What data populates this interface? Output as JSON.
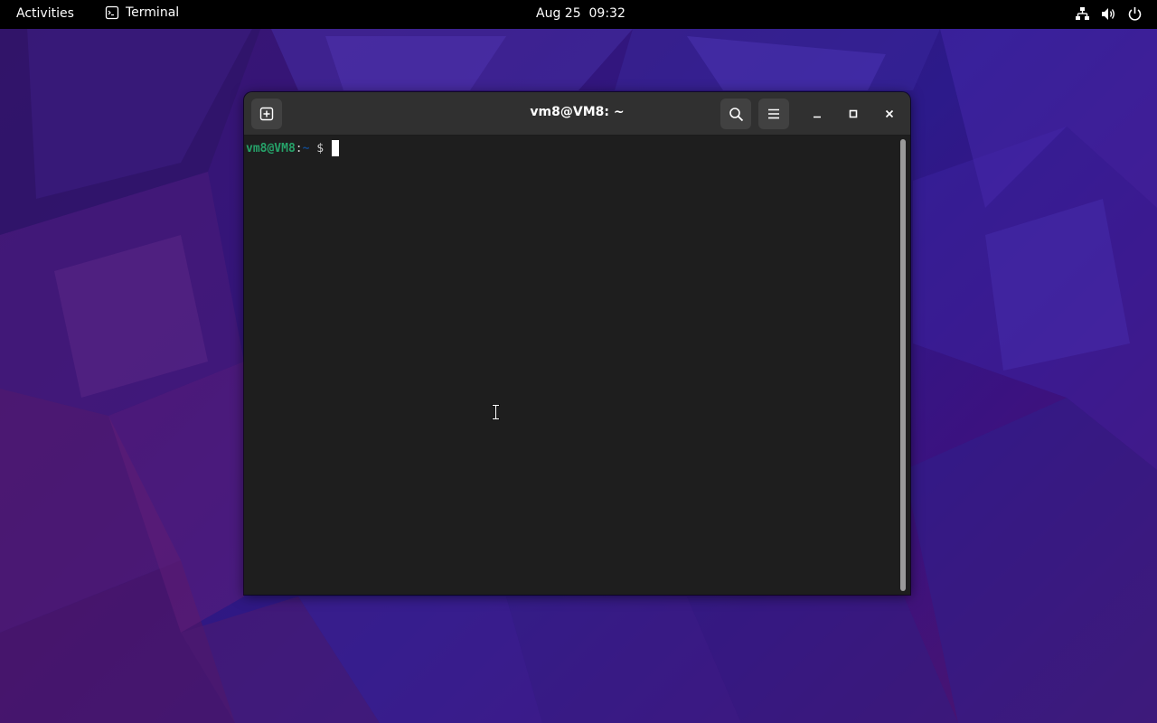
{
  "topbar": {
    "activities": "Activities",
    "app_name": "Terminal",
    "app_icon": "terminal-icon",
    "clock": "Aug 25  09:32",
    "tray_icons": [
      "network-icon",
      "volume-icon",
      "power-icon"
    ]
  },
  "terminal": {
    "title": "vm8@VM8: ~",
    "header_buttons": [
      "new-tab-icon",
      "search-icon",
      "hamburger-menu-icon"
    ],
    "window_controls": [
      "minimize-icon",
      "maximize-icon",
      "close-icon"
    ],
    "prompt": {
      "user_host": "vm8@VM8",
      "separator": ":",
      "path": "~",
      "symbol": "$"
    }
  },
  "colors": {
    "topbar_bg": "#000000",
    "headerbar_bg": "#303030",
    "terminal_bg": "#1e1e1e",
    "prompt_user": "#26a269",
    "prompt_path": "#12488b",
    "wallpaper_accent": "#3a1a8a"
  }
}
